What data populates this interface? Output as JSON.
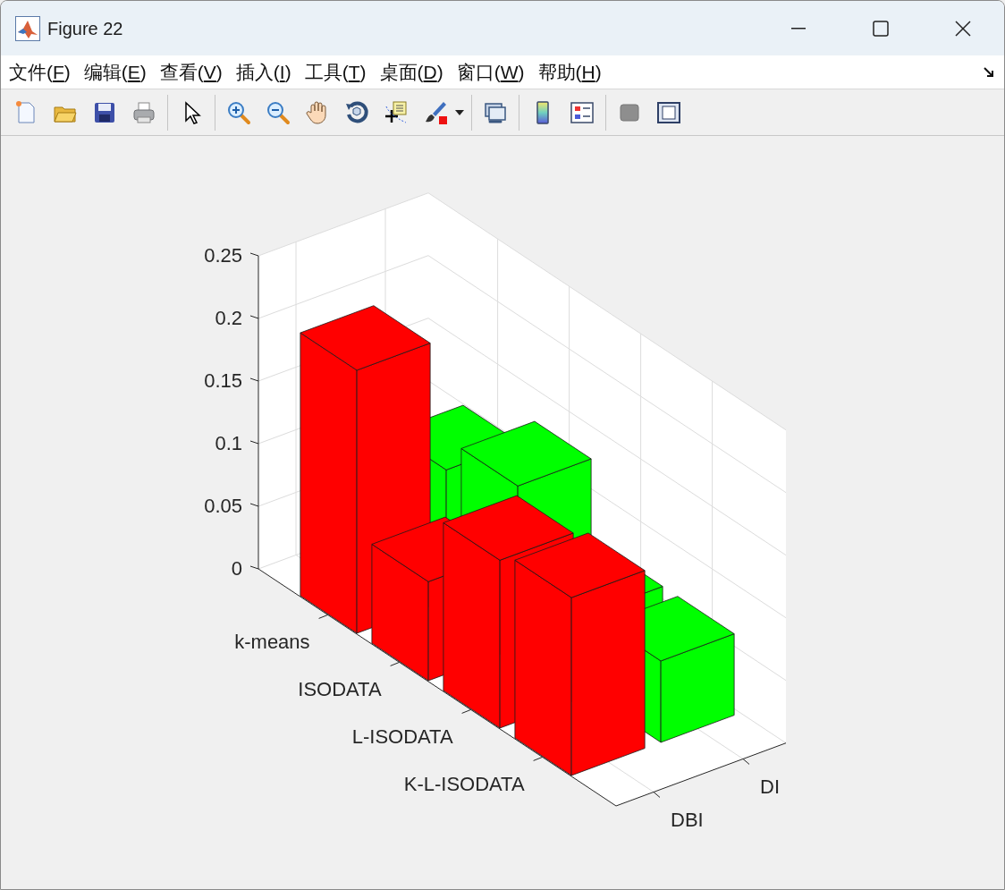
{
  "window": {
    "title": "Figure 22"
  },
  "menu": [
    {
      "label": "文件(F)"
    },
    {
      "label": "编辑(E)"
    },
    {
      "label": "查看(V)"
    },
    {
      "label": "插入(I)"
    },
    {
      "label": "工具(T)"
    },
    {
      "label": "桌面(D)"
    },
    {
      "label": "窗口(W)"
    },
    {
      "label": "帮助(H)"
    }
  ],
  "figure": {
    "z_tick_labels": [
      "0.25",
      "0.2",
      "0.15",
      "0.1",
      "0.05",
      "0"
    ],
    "x_tick_labels": [
      "k-means",
      "ISODATA",
      "L-ISODATA",
      "K-L-ISODATA"
    ],
    "y_tick_labels": [
      {
        "label": "DBI",
        "color": "#ff0000"
      },
      {
        "label": "DI",
        "color": "#00ff00"
      }
    ]
  }
}
